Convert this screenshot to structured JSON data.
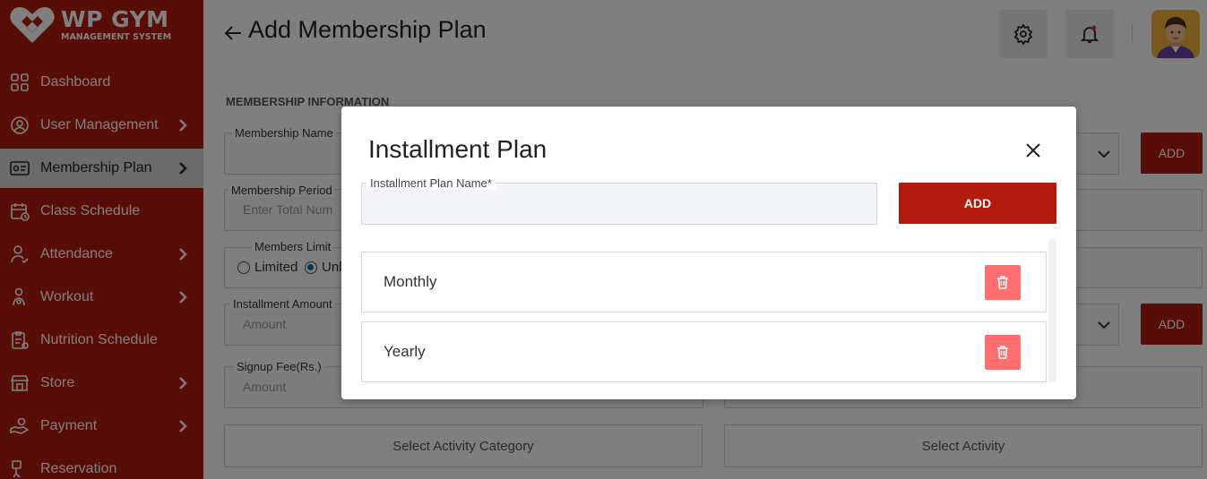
{
  "app": {
    "logo_title": "WP GYM",
    "logo_subtitle": "MANAGEMENT SYSTEM",
    "brand_color": "#b31b0e"
  },
  "sidebar": {
    "items": [
      {
        "label": "Dashboard",
        "icon": "dashboard-grid-icon",
        "has_submenu": false,
        "active": false
      },
      {
        "label": "User Management",
        "icon": "users-gear-icon",
        "has_submenu": true,
        "active": false
      },
      {
        "label": "Membership Plan",
        "icon": "membership-card-icon",
        "has_submenu": true,
        "active": true
      },
      {
        "label": "Class Schedule",
        "icon": "calendar-icon",
        "has_submenu": false,
        "active": false
      },
      {
        "label": "Attendance",
        "icon": "user-check-icon",
        "has_submenu": true,
        "active": false
      },
      {
        "label": "Workout",
        "icon": "workout-icon",
        "has_submenu": true,
        "active": false
      },
      {
        "label": "Nutrition Schedule",
        "icon": "clipboard-icon",
        "has_submenu": false,
        "active": false
      },
      {
        "label": "Store",
        "icon": "store-icon",
        "has_submenu": true,
        "active": false
      },
      {
        "label": "Payment",
        "icon": "payment-hand-icon",
        "has_submenu": true,
        "active": false
      },
      {
        "label": "Reservation",
        "icon": "reservation-icon",
        "has_submenu": false,
        "active": false
      }
    ]
  },
  "header": {
    "title": "Add Membership Plan",
    "settings_icon": "gear-icon",
    "notification_icon": "bell-icon"
  },
  "form": {
    "section_label": "MEMBERSHIP INFORMATION",
    "membership_name_label": "Membership Name",
    "membership_period_label": "Membership Period",
    "membership_period_placeholder": "Enter Total Num",
    "members_limit_label": "Members Limit",
    "limited_label": "Limited",
    "unlimited_label": "Unl",
    "installment_amount_label": "Installment Amount",
    "installment_amount_placeholder": "Amount",
    "signup_fee_label": "Signup Fee(Rs.)",
    "signup_fee_placeholder": "Amount",
    "add_label_1": "ADD",
    "add_label_2": "ADD",
    "select_activity_category": "Select Activity Category",
    "select_activity": "Select Activity"
  },
  "modal": {
    "title": "Installment Plan",
    "input_label": "Installment Plan Name*",
    "input_value": "",
    "add_button": "ADD",
    "plans": [
      {
        "name": "Monthly"
      },
      {
        "name": "Yearly"
      }
    ],
    "delete_color": "#ff6f6f"
  }
}
